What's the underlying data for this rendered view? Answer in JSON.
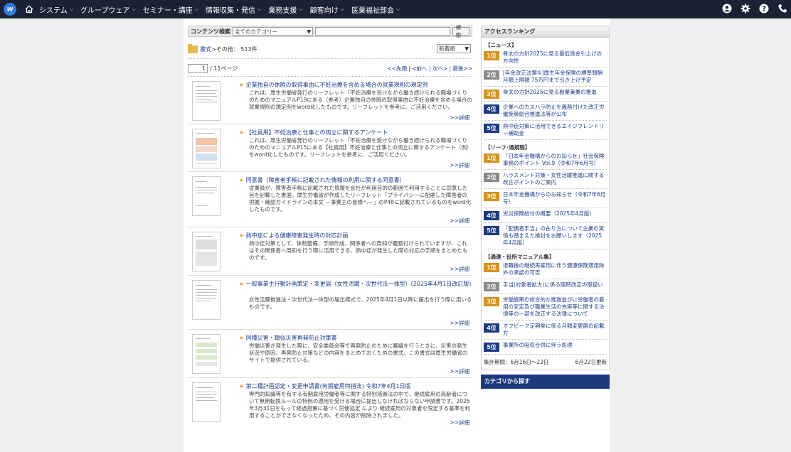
{
  "topnav": {
    "logo_text": "W",
    "items": [
      "システム",
      "グループウェア",
      "セミナー・講座",
      "情報収集・発信",
      "業務支援",
      "顧客向け",
      "医業福祉部会"
    ]
  },
  "search": {
    "label": "コンテンツ検索",
    "category": "全てのカテゴリー",
    "button": "検索"
  },
  "breadcrumb": {
    "root": "書式",
    "sep": " > ",
    "current": "その他",
    "count": " ： 513件"
  },
  "sort": "新着順",
  "pager": {
    "page": "1",
    "total": "/ 11ページ",
    "links": "<<先頭 | <前へ | 次へ> | 最後>>"
  },
  "items": [
    {
      "title": "企業独自の休暇の取得事由に不妊治療を含める場合の就業規則の規定例",
      "desc": "これは、厚生労働省発行のリーフレット「不妊治療を受けながら働き続けられる職場づくりのためのマニュアルP19にある（参考）企業独自の休暇の取得事由に不妊治療を含める場合の就業規則の規定例をword化したものです。リーフレットを参考に、ご活用ください。",
      "more": ">>詳細"
    },
    {
      "title": "【社員用】不妊治療と仕事との両立に関するアンケート",
      "desc": "これは、厚生労働省発行のリーフレット「不妊治療を受けながら働き続けられる職場づくりのためのマニュアルP15にある【社員用】不妊治療と仕事との両立に関するアンケート（例）をword化したものです。リーフレットを参考に、ご活用ください。",
      "more": ">>詳細"
    },
    {
      "title": "同意書（障害者手帳に記載された情報の利用に関する同意書）",
      "desc": "従業員が、障害者手帳に記載された情報を会社が利用目的の範囲で利用することに同意した旨を記載した書面。厚生労働省が作成したリーフレット「プライバシーに配慮した障害者の把握・確認ガイドラインの本文 －事業主の皆様へ－」のP48に記載されているものをword化したものです。",
      "more": ">>詳細"
    },
    {
      "title": "熱中症による健康障害発生時の対応計画",
      "desc": "熱中症対策として、体制整備、手順作成、関係者への周知が義務付けられていますが、これはその関係者へ周知を行う際に活用できる、熱中症が発生した際の対応の手順をまとめたものです。",
      "more": ">>詳細"
    },
    {
      "title": "一般事業主行動計画策定・変更届（女性活躍・次世代法一体型）(2025年4月1日改訂版)",
      "desc": "女性活躍推進法・次世代法一体型の届出様式で、2025年4月1日以降に届出を行う際に用いるものです。",
      "more": ">>詳細"
    },
    {
      "title": "同種災害・類似災害再発防止対策書",
      "desc": "労働災害が発生した際に、安全委員会等で再発防止のために審議を行うときに、災害の発生状況や原因、再発防止対策などの内容をまとめておくための書式。この書式は厚生労働省のサイトで提供されている。",
      "more": ">>詳細"
    },
    {
      "title": "第二種計画認定・変更申請書(有期雇用特措法) 令和7年4月1日版",
      "desc": "専門的知識等を有する有期雇用労働者等に関する特別措置法の中で、継続雇用の高齢者について無期転換ルールの特例の適用を受ける場合に提出しなければならない申請書です。2025年3月31日をもって経過措置に基づく労使協定 により 継続雇用の対象者を限定する基準を利用することができなくなったため、その内容が削除されました。",
      "more": ">>詳細"
    }
  ],
  "ranking": {
    "title": "アクセスランキング",
    "groups": [
      {
        "name": "【ニュース】",
        "rows": [
          {
            "rank": "1位",
            "text": "骨太の方針2025に見る最低賃金引上げの方向性"
          },
          {
            "rank": "2位",
            "text": "[年金改正法案⑤]厚生年金保険の標準報酬月額上限額 75万円まで引き上げ予定"
          },
          {
            "rank": "3位",
            "text": "骨太の方針2025に見る副業兼業の推進"
          },
          {
            "rank": "4位",
            "text": "企業へのカスハラ防止を義務付けた改正労働施策総合推進法等が公布"
          },
          {
            "rank": "5位",
            "text": "熱中症対策に活用できるエイジフレンドリー補助金"
          }
        ]
      },
      {
        "name": "【リーフ･通規程】",
        "rows": [
          {
            "rank": "1位",
            "text": "「日本年金機構からのお知らせ」社会保険事務のポイント Vol.9（令和7年6月号）"
          },
          {
            "rank": "2位",
            "text": "ハラスメント対策・女性活躍推進に関する改正ポイントのご案内"
          },
          {
            "rank": "3位",
            "text": "日本年金機構からのお知らせ（令和7年6月号）"
          },
          {
            "rank": "4位",
            "text": "労災保険給付の概要（2025年4月版）"
          },
          {
            "rank": "5位",
            "text": "「配偶者手当」の在り方について企業の実情も踏まえた検討をお願いします（2025年4月版）"
          }
        ]
      },
      {
        "name": "【通達・役所マニュアル集】",
        "rows": [
          {
            "rank": "1位",
            "text": "退職後の継続再雇用に伴う健康保険適用除外の承認の可否"
          },
          {
            "rank": "2位",
            "text": "手当(対象者拡大)に係る随時改定の取扱い"
          },
          {
            "rank": "3位",
            "text": "労働施策の総合的な推進並びに労働者の雇用の安定及び職業生活の充実等に関する法律等の一部を改正する法律について"
          },
          {
            "rank": "4位",
            "text": "オフピーク定期券に係る月額変更届の記載方"
          },
          {
            "rank": "5位",
            "text": "事業所の吸収合併に伴う処理"
          }
        ]
      }
    ],
    "period": "集計期間：6月16日～22日",
    "updated": "6月22日更新"
  },
  "category_box": "カテゴリから探す"
}
